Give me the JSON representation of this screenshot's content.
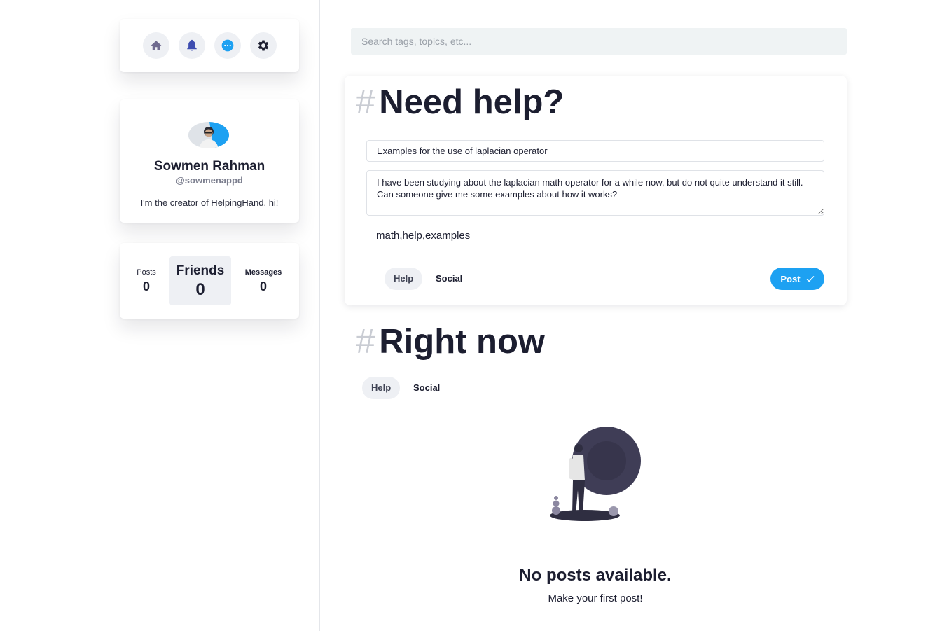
{
  "nav": {
    "icons": [
      "home-icon",
      "bell-icon",
      "message-icon",
      "gear-icon"
    ],
    "colors": {
      "home": "#6f6a8f",
      "bell": "#3e4db0",
      "message": "#1da1f2",
      "gear": "#1c1e30"
    }
  },
  "profile": {
    "name": "Sowmen Rahman",
    "handle": "@sowmenappd",
    "bio": "I'm the creator of HelpingHand, hi!"
  },
  "stats": {
    "posts_label": "Posts",
    "posts_value": "0",
    "friends_label": "Friends",
    "friends_value": "0",
    "messages_label": "Messages",
    "messages_value": "0"
  },
  "search": {
    "placeholder": "Search tags, topics, etc..."
  },
  "compose": {
    "hash": "#",
    "title": "Need help?",
    "post_title": "Examples for the use of laplacian operator",
    "post_body": "I have been studying about the laplacian math operator for a while now, but do not quite understand it still. Can someone give me some examples about how it works?",
    "tags": "math,help,examples",
    "tabs": [
      "Help",
      "Social"
    ],
    "active_tab": "Help",
    "post_button": "Post"
  },
  "feed": {
    "hash": "#",
    "title": "Right now",
    "tabs": [
      "Help",
      "Social"
    ],
    "active_tab": "Help",
    "empty_title": "No posts available.",
    "empty_subtitle": "Make your first post!"
  },
  "colors": {
    "accent": "#1da1f2",
    "text": "#1c1e30",
    "muted": "#7b7e8e",
    "surface": "#eef0f4"
  }
}
